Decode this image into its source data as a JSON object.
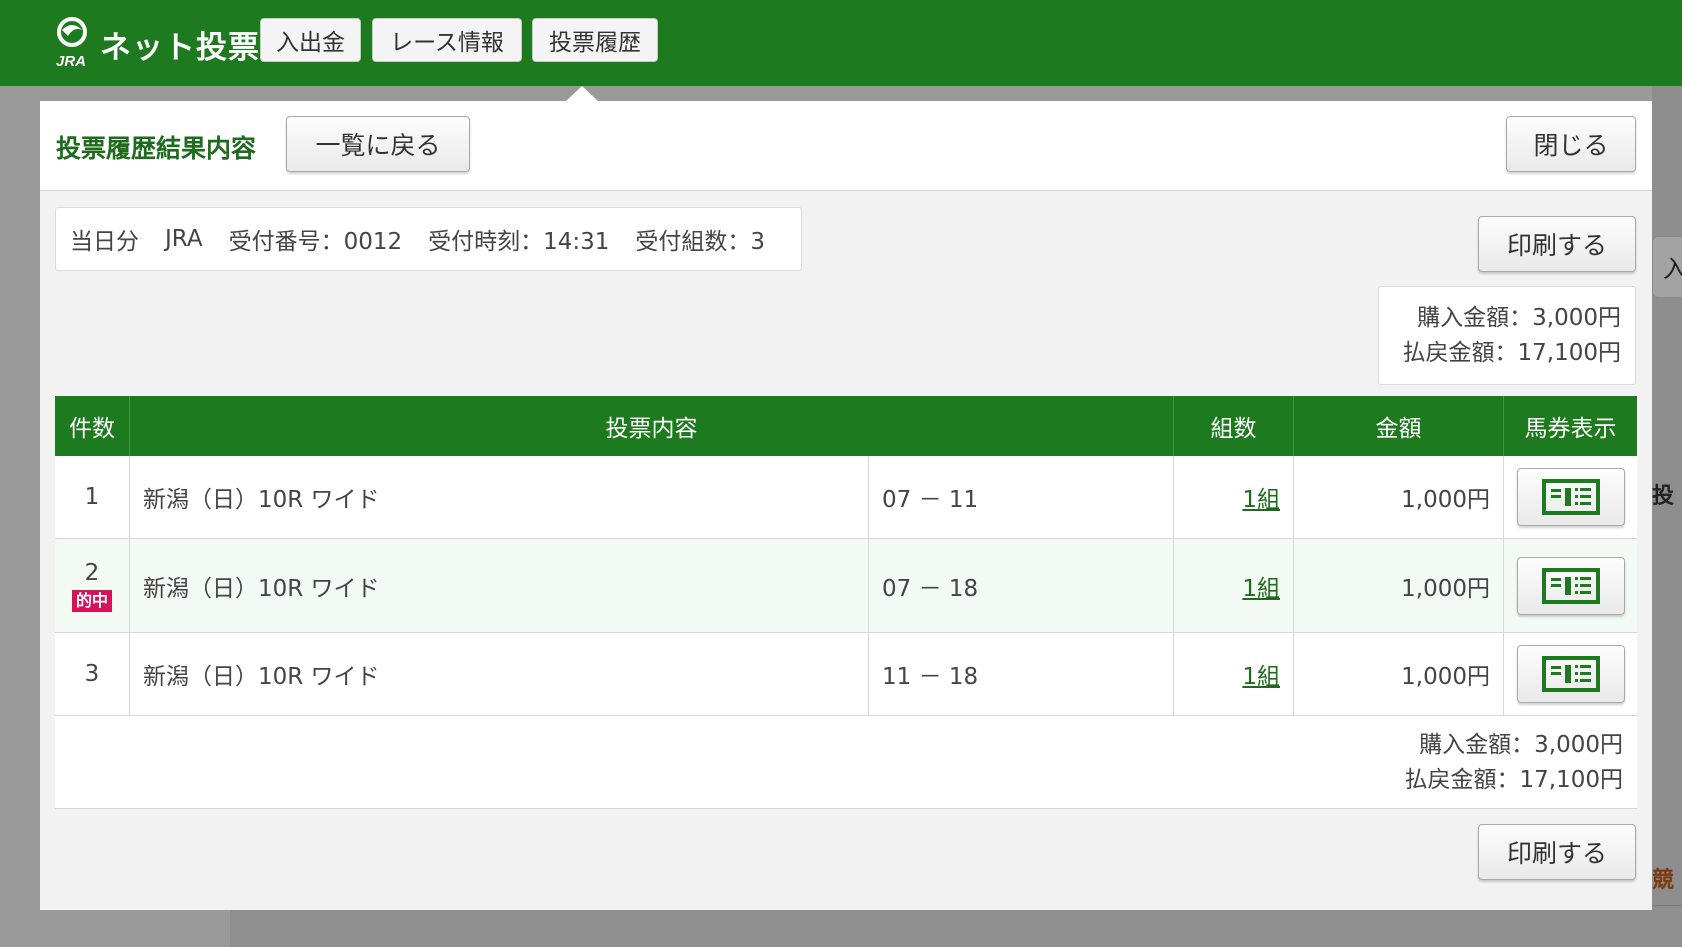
{
  "header": {
    "logo_sub": "JRA",
    "logo_text": "ネット投票",
    "nav": [
      "入出金",
      "レース情報",
      "投票履歴"
    ]
  },
  "background": {
    "card_text": "入",
    "frag_1": "投",
    "frag_2": "競"
  },
  "dialog": {
    "title": "投票履歴結果内容",
    "back_label": "一覧に戻る",
    "close_label": "閉じる",
    "print_label": "印刷する",
    "info": {
      "day": "当日分",
      "org": "JRA",
      "receipt_no": "受付番号：0012",
      "receipt_time": "受付時刻：14:31",
      "receipt_count": "受付組数：3"
    },
    "summary": {
      "purchase": "購入金額：3,000円",
      "payout": "払戻金額：17,100円"
    },
    "table": {
      "headers": [
        "件数",
        "投票内容",
        "組数",
        "金額",
        "馬券表示"
      ],
      "rows": [
        {
          "no": "1",
          "race": "新潟（日）10R ワイド",
          "combo": "07 － 11",
          "sets": "1組",
          "amount": "1,000円",
          "hit": ""
        },
        {
          "no": "2",
          "race": "新潟（日）10R ワイド",
          "combo": "07 － 18",
          "sets": "1組",
          "amount": "1,000円",
          "hit": "的中"
        },
        {
          "no": "3",
          "race": "新潟（日）10R ワイド",
          "combo": "11 － 18",
          "sets": "1組",
          "amount": "1,000円",
          "hit": ""
        }
      ],
      "footer": {
        "purchase": "購入金額：3,000円",
        "payout": "払戻金額：17,100円"
      }
    },
    "colors": {
      "brand_green": "#1e7a1e",
      "hit_badge": "#d4145a"
    },
    "icons": {
      "ticket": "ticket-icon"
    }
  }
}
